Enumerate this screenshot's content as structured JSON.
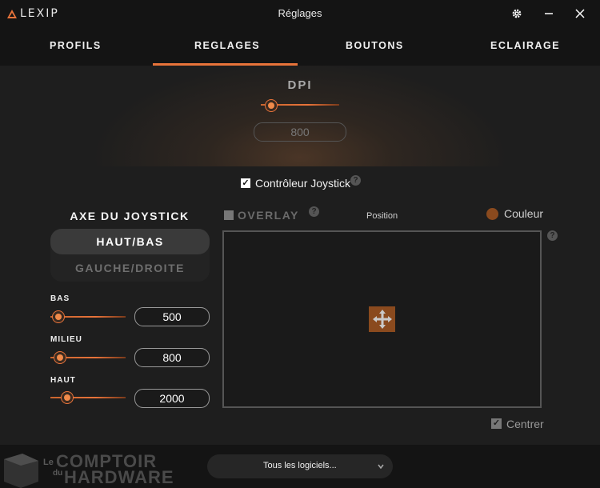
{
  "app": {
    "brand": "LEXIP",
    "window_title": "Réglages"
  },
  "titlebar": {
    "settings_icon": "gear-icon",
    "minimize_icon": "minimize-icon",
    "close_icon": "close-icon"
  },
  "tabs": [
    {
      "label": "PROFILS",
      "active": false
    },
    {
      "label": "REGLAGES",
      "active": true
    },
    {
      "label": "BOUTONS",
      "active": false
    },
    {
      "label": "ECLAIRAGE",
      "active": false
    }
  ],
  "dpi": {
    "label": "DPI",
    "value": "800",
    "slider_fraction": 0.15
  },
  "joystick_controller": {
    "label": "Contrôleur Joystick",
    "checked": true
  },
  "axis": {
    "title": "AXE DU JOYSTICK",
    "options": [
      "HAUT/BAS",
      "GAUCHE/DROITE"
    ],
    "selected": "HAUT/BAS"
  },
  "sliders": [
    {
      "label": "BAS",
      "value": "500",
      "fraction": 0.1
    },
    {
      "label": "MILIEU",
      "value": "800",
      "fraction": 0.13
    },
    {
      "label": "HAUT",
      "value": "2000",
      "fraction": 0.23
    }
  ],
  "overlay": {
    "label": "OVERLAY",
    "checked": false,
    "position_label": "Position",
    "color_label": "Couleur",
    "color": "#8a4a1e"
  },
  "centrer": {
    "label": "Centrer",
    "checked": true
  },
  "software_select": {
    "value": "Tous les logiciels..."
  },
  "watermark": {
    "line1": "Le",
    "line2": "du",
    "brand1": "COMPTOIR",
    "brand2": "HARDWARE"
  },
  "colors": {
    "accent": "#e8733a",
    "background": "#1e1e1e",
    "bar": "#141414"
  }
}
